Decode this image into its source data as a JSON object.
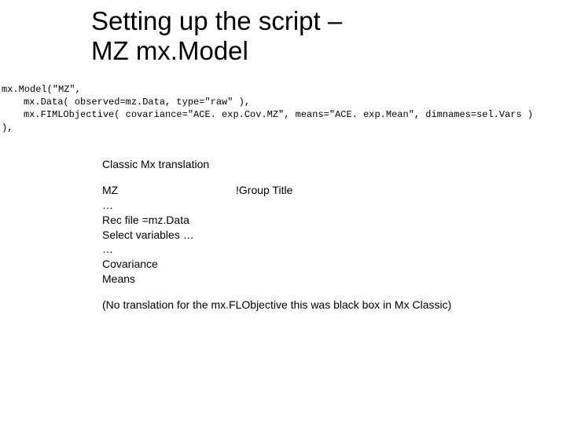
{
  "title": "Setting up the script –\nMZ mx.Model",
  "code": {
    "line1": "mx.Model(\"MZ\",",
    "line2": "mx.Data( observed=mz.Data, type=\"raw\" ),",
    "line3": "mx.FIMLObjective( covariance=\"ACE. exp.Cov.MZ\", means=\"ACE. exp.Mean\", dimnames=sel.Vars )",
    "line4": "),"
  },
  "body": {
    "classic": "Classic Mx translation",
    "mz_left": "MZ",
    "mz_right": "!Group Title",
    "ellipsis1": "…",
    "rec": "Rec file =mz.Data",
    "select": "Select variables …",
    "ellipsis2": "…",
    "cov": "Covariance",
    "means": "Means",
    "note": "(No translation for the mx.FLObjective this was black box in Mx Classic)"
  }
}
